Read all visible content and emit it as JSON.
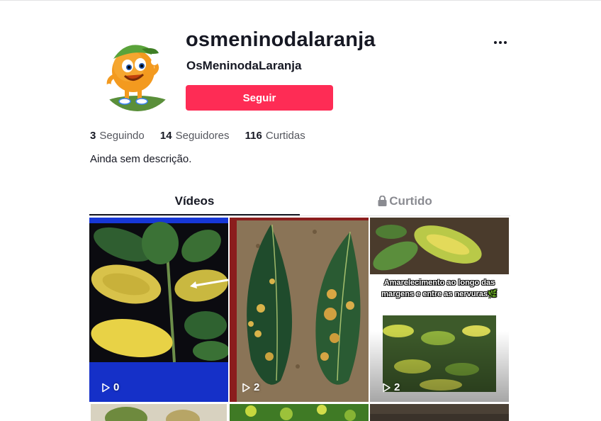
{
  "profile": {
    "username": "osmeninodalaranja",
    "nickname": "OsMeninodaLaranja",
    "follow_label": "Seguir",
    "bio": "Ainda sem descrição."
  },
  "stats": {
    "following_count": "3",
    "following_label": "Seguindo",
    "followers_count": "14",
    "followers_label": "Seguidores",
    "likes_count": "116",
    "likes_label": "Curtidas"
  },
  "tabs": {
    "videos": "Vídeos",
    "liked": "Curtido"
  },
  "videos": [
    {
      "views": "0"
    },
    {
      "views": "2"
    },
    {
      "views": "2",
      "overlay_text": "Amarelecimento ao longo das margens e entre as nervuras🌿"
    }
  ],
  "colors": {
    "accent": "#fe2c55",
    "text": "#161823",
    "muted": "#8a8b91"
  },
  "icons": [
    "more-icon",
    "lock-icon",
    "play-icon"
  ]
}
